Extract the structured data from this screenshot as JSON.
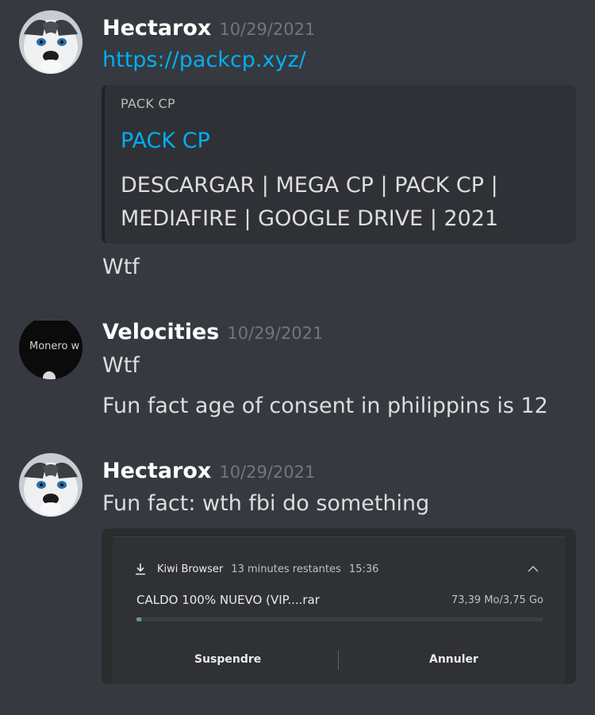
{
  "messages": [
    {
      "username": "Hectarox",
      "timestamp": "10/29/2021",
      "link": "https://packcp.xyz/",
      "embed": {
        "provider": "PACK CP",
        "title": "PACK CP",
        "description": "DESCARGAR | MEGA CP | PACK CP | MEDIAFIRE | GOOGLE DRIVE | 2021"
      },
      "followup": "Wtf"
    },
    {
      "username": "Velocities",
      "timestamp": "10/29/2021",
      "avatar_text": "Monero w",
      "lines": [
        "Wtf",
        "Fun fact age of consent in philippins is 12"
      ]
    },
    {
      "username": "Hectarox",
      "timestamp": "10/29/2021",
      "text": "Fun fact: wth fbi do something",
      "attachment": {
        "app": "Kiwi Browser",
        "status": "13 minutes restantes",
        "time": "15:36",
        "file_name": "CALDO 100% NUEVO (VIP....rar",
        "file_size": "73,39 Mo/3,75 Go",
        "progress_fraction": 0.012,
        "pause_label": "Suspendre",
        "cancel_label": "Annuler"
      }
    }
  ],
  "colors": {
    "background": "#36393f",
    "link": "#00aff4",
    "username": "#ffffff",
    "timestamp": "#72767d",
    "embed_bg": "#2f3136",
    "progress": "#5f9d85"
  }
}
